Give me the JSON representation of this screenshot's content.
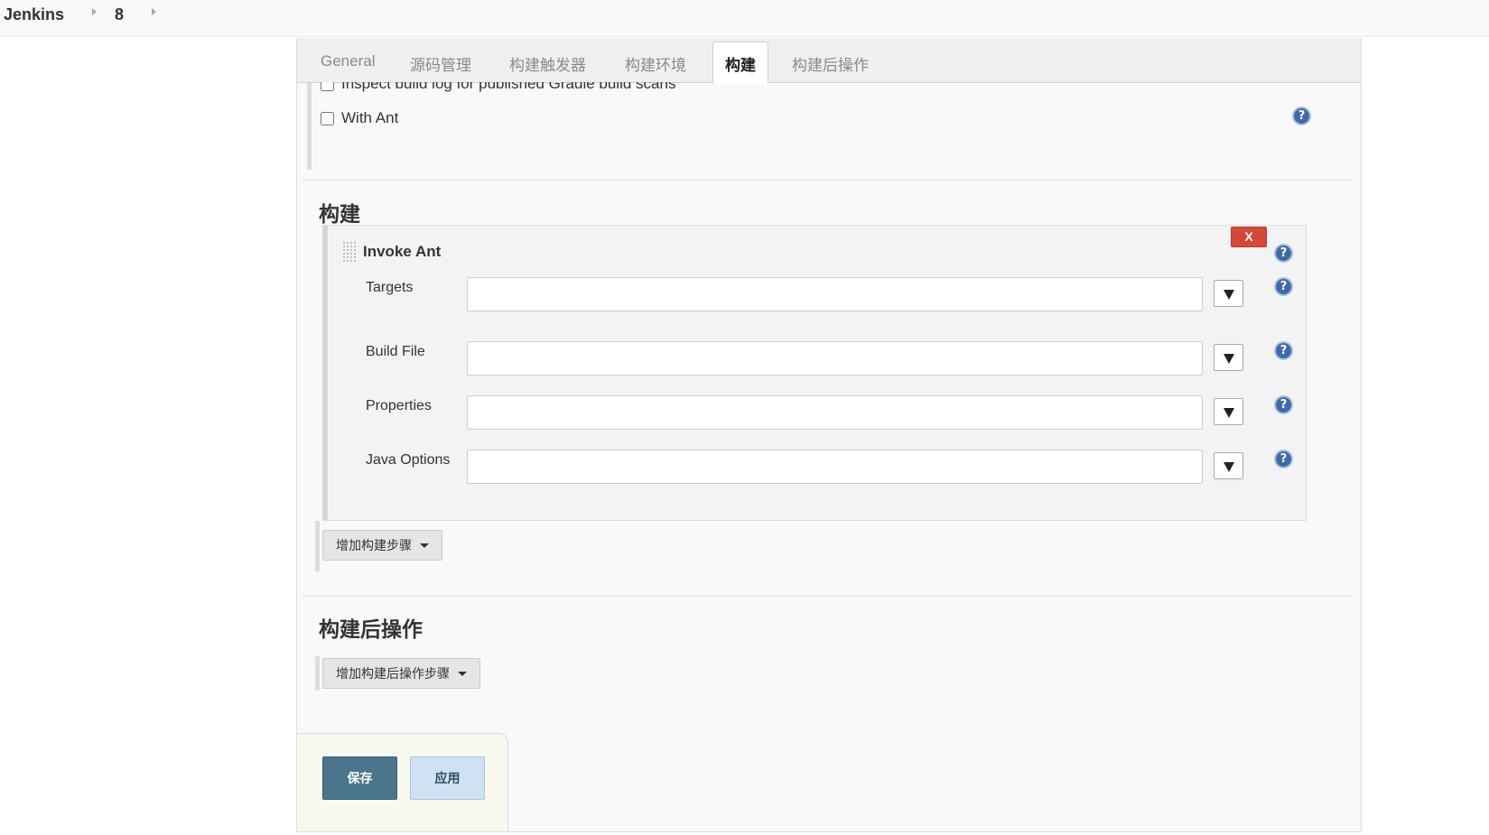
{
  "breadcrumb": {
    "items": [
      "Jenkins",
      "8"
    ]
  },
  "tabs": [
    {
      "label": "General",
      "active": false
    },
    {
      "label": "源码管理",
      "active": false
    },
    {
      "label": "构建触发器",
      "active": false
    },
    {
      "label": "构建环境",
      "active": false
    },
    {
      "label": "构建",
      "active": true
    },
    {
      "label": "构建后操作",
      "active": false
    }
  ],
  "build_env": {
    "clipped_option": "Inspect build log for published Gradle build scans",
    "with_ant_label": "With Ant"
  },
  "build_section": {
    "title": "构建",
    "step": {
      "title": "Invoke Ant",
      "delete_label": "X",
      "fields": [
        {
          "label": "Targets",
          "value": ""
        },
        {
          "label": "Build File",
          "value": ""
        },
        {
          "label": "Properties",
          "value": ""
        },
        {
          "label": "Java Options",
          "value": ""
        }
      ]
    },
    "add_step_label": "增加构建步骤"
  },
  "post_build_section": {
    "title": "构建后操作",
    "add_step_label": "增加构建后操作步骤"
  },
  "actions": {
    "save_label": "保存",
    "apply_label": "应用"
  },
  "icons": {
    "help": "?"
  },
  "colors": {
    "save_button": "#4b758b",
    "apply_button": "#cfe2f3",
    "delete_button": "#d24939",
    "help_icon": "#3f6aa8"
  }
}
